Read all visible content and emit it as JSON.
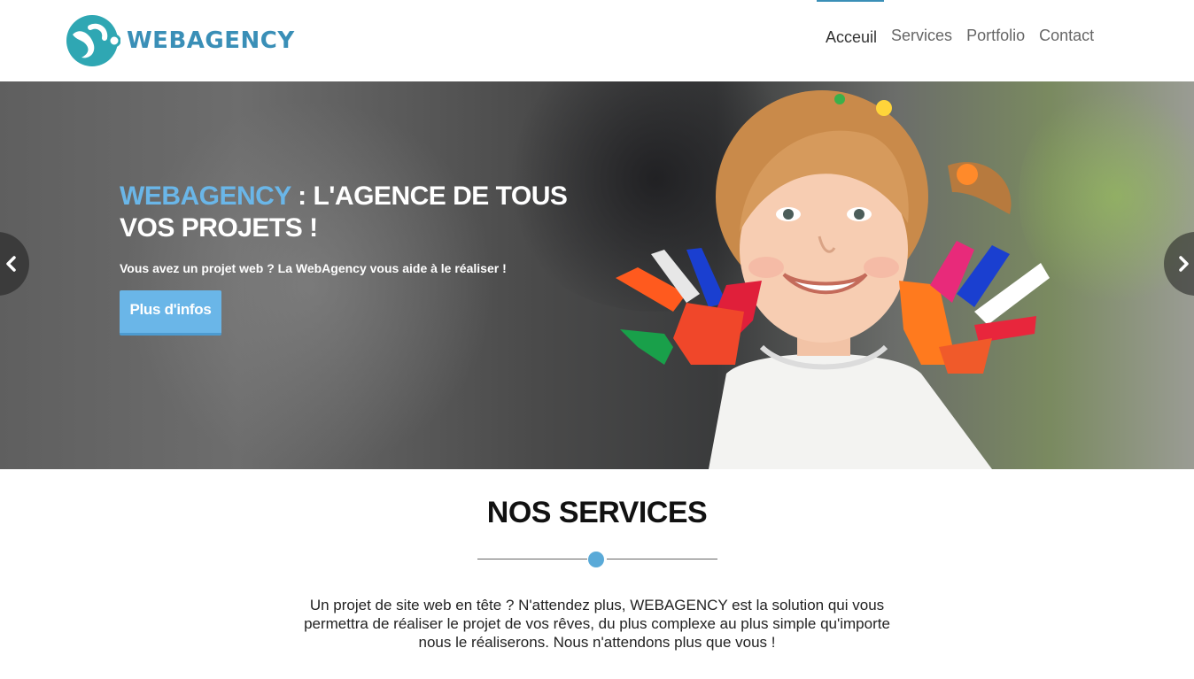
{
  "header": {
    "logo_text": "WEBAGENCY",
    "nav": [
      {
        "label": "Acceuil",
        "active": true
      },
      {
        "label": "Services",
        "active": false
      },
      {
        "label": "Portfolio",
        "active": false
      },
      {
        "label": "Contact",
        "active": false
      }
    ]
  },
  "hero": {
    "title_accent": "WEBAGENCY",
    "title_rest": " : L'AGENCE DE TOUS VOS PROJETS !",
    "subtitle": "Vous avez un projet web ? La WebAgency vous aide à le réaliser !",
    "button_label": "Plus d'infos",
    "prev_icon": "chevron-left-icon",
    "next_icon": "chevron-right-icon"
  },
  "services": {
    "title": "NOS SERVICES",
    "text": "Un projet de site web en tête ? N'attendez plus, WEBAGENCY est la solution qui vous permettra de réaliser le projet de vos rêves, du plus complexe au plus simple qu'importe nous le réaliserons. Nous n'attendons plus que vous !"
  },
  "colors": {
    "brand": "#3a8fb7",
    "accent": "#6ab6e8",
    "divider_dot": "#5aaad8"
  }
}
